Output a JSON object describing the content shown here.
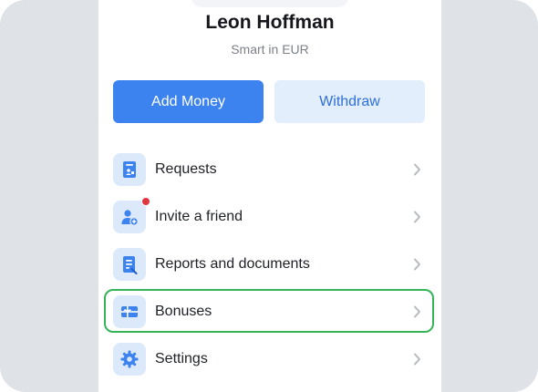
{
  "profile": {
    "name": "Leon Hoffman",
    "subtitle": "Smart in EUR"
  },
  "actions": {
    "add_money": "Add Money",
    "withdraw": "Withdraw"
  },
  "menu": [
    {
      "label": "Requests",
      "icon": "request-document-icon"
    },
    {
      "label": "Invite a friend",
      "icon": "add-user-icon",
      "badge": "red-notification-dot"
    },
    {
      "label": "Reports and documents",
      "icon": "report-document-icon"
    },
    {
      "label": "Bonuses",
      "icon": "gift-card-icon",
      "highlighted": true
    },
    {
      "label": "Settings",
      "icon": "gear-icon"
    }
  ],
  "colors": {
    "accent": "#3d83f0",
    "accent_light": "#dce9fb",
    "highlight": "#35b45a",
    "badge": "#e0363d"
  }
}
